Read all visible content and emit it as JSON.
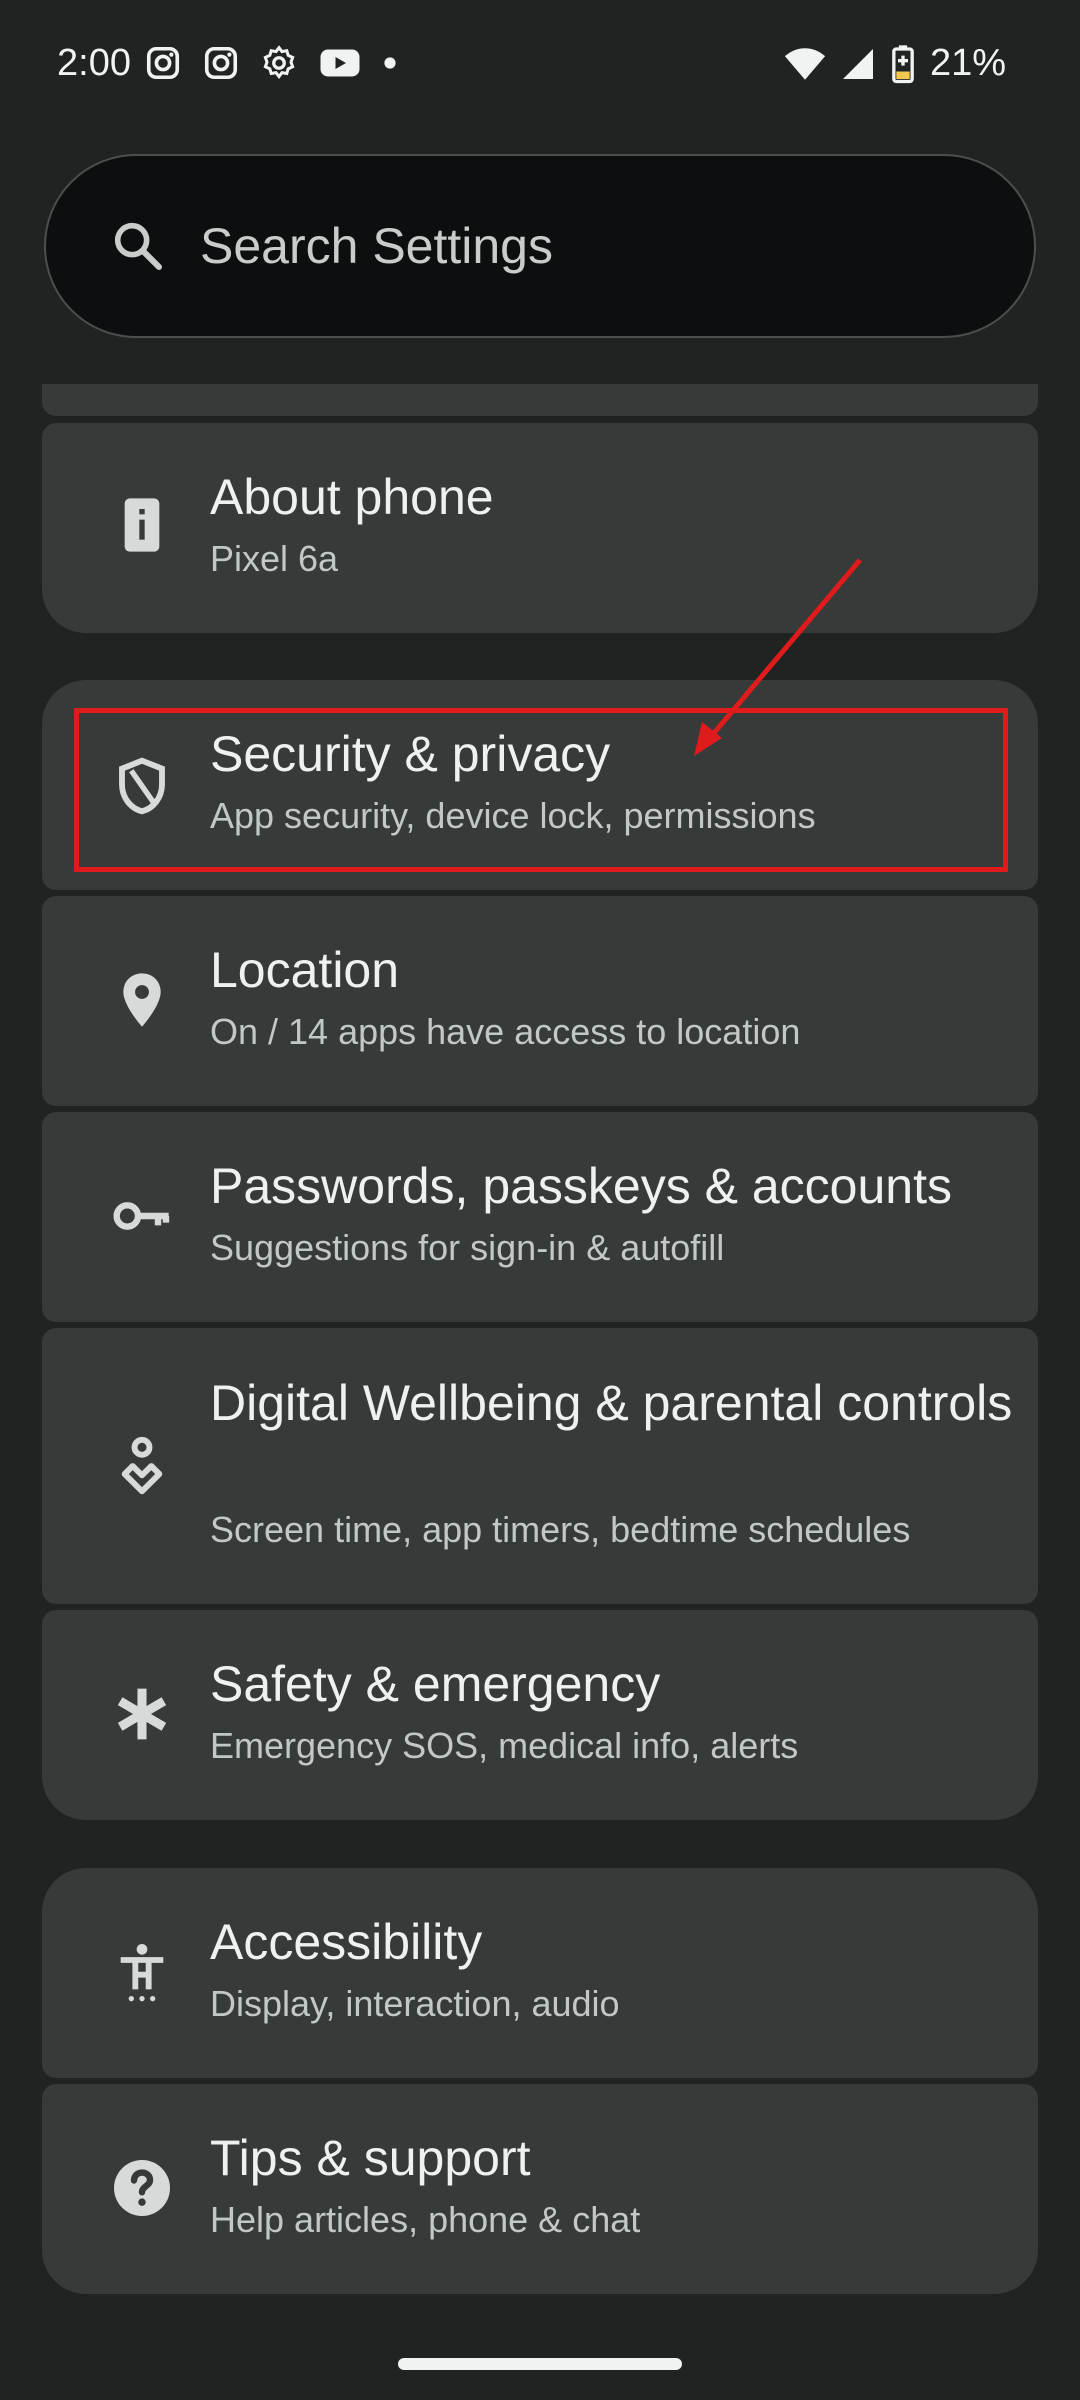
{
  "status_bar": {
    "time": "2:00",
    "left_icons": [
      "instagram-icon",
      "instagram-icon",
      "settings-gear-icon",
      "youtube-icon",
      "notification-dot-icon"
    ],
    "battery_percent": "21%"
  },
  "search": {
    "placeholder": "Search Settings"
  },
  "settings_items": [
    {
      "title": "About phone",
      "subtitle": "Pixel 6a",
      "icon": "phone-info-icon"
    },
    {
      "title": "Security & privacy",
      "subtitle": "App security, device lock, permissions",
      "icon": "shield-icon"
    },
    {
      "title": "Location",
      "subtitle": "On / 14 apps have access to location",
      "icon": "location-pin-icon"
    },
    {
      "title": "Passwords, passkeys & accounts",
      "subtitle": "Suggestions for sign-in & autofill",
      "icon": "key-icon"
    },
    {
      "title": "Digital Wellbeing & parental controls",
      "subtitle": "Screen time, app timers, bedtime schedules",
      "icon": "wellbeing-icon"
    },
    {
      "title": "Safety & emergency",
      "subtitle": "Emergency SOS, medical info, alerts",
      "icon": "asterisk-icon"
    },
    {
      "title": "Accessibility",
      "subtitle": "Display, interaction, audio",
      "icon": "accessibility-icon"
    },
    {
      "title": "Tips & support",
      "subtitle": "Help articles, phone & chat",
      "icon": "help-icon"
    }
  ],
  "colors": {
    "background": "#1f2322",
    "card": "#363b3a",
    "highlight": "#e01b1b",
    "battery_fill": "#f2c94c"
  }
}
